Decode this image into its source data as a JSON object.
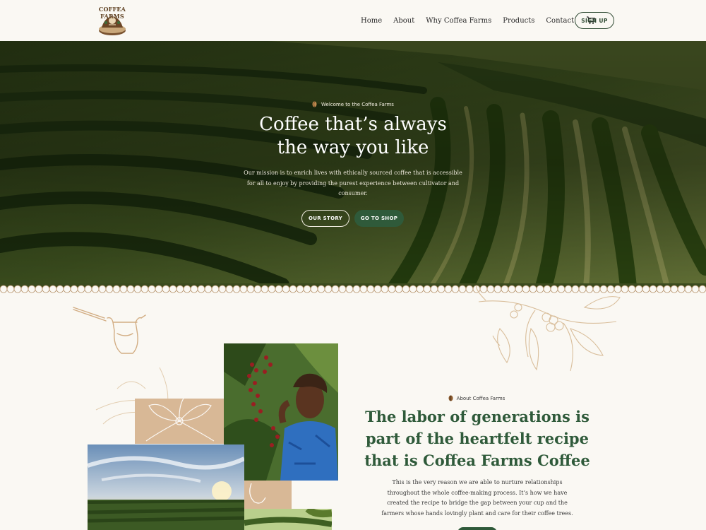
{
  "header": {
    "logo_text": "COFFEA FARMS",
    "nav": [
      "Home",
      "About",
      "Why Coffea Farms",
      "Products",
      "Contact"
    ],
    "cart_icon": "cart-icon",
    "signup_label": "SIGN UP"
  },
  "hero": {
    "eyebrow": "Welcome to the Coffea Farms",
    "title_line1": "Coffee that’s always",
    "title_line2": "the way you like",
    "subtitle": "Our mission is to enrich lives with ethically sourced coffee that is accessible for all to enjoy by providing the purest experience between cultivator and consumer.",
    "btn_story": "OUR STORY",
    "btn_shop": "GO TO SHOP"
  },
  "about": {
    "eyebrow": "About Coffea Farms",
    "title": "The labor of generations is part of the heartfelt recipe that is Coffea Farms Coffee",
    "body": "This is the very reason we are able to nurture relationships throughout the whole coffee-making process. It’s how we have created the recipe to bridge the gap between your cup and the farmers whose hands lovingly plant and care for their coffee trees."
  },
  "colors": {
    "brand_green": "#2f5a3a",
    "cream": "#faf8f3",
    "tan": "#d8b896"
  }
}
